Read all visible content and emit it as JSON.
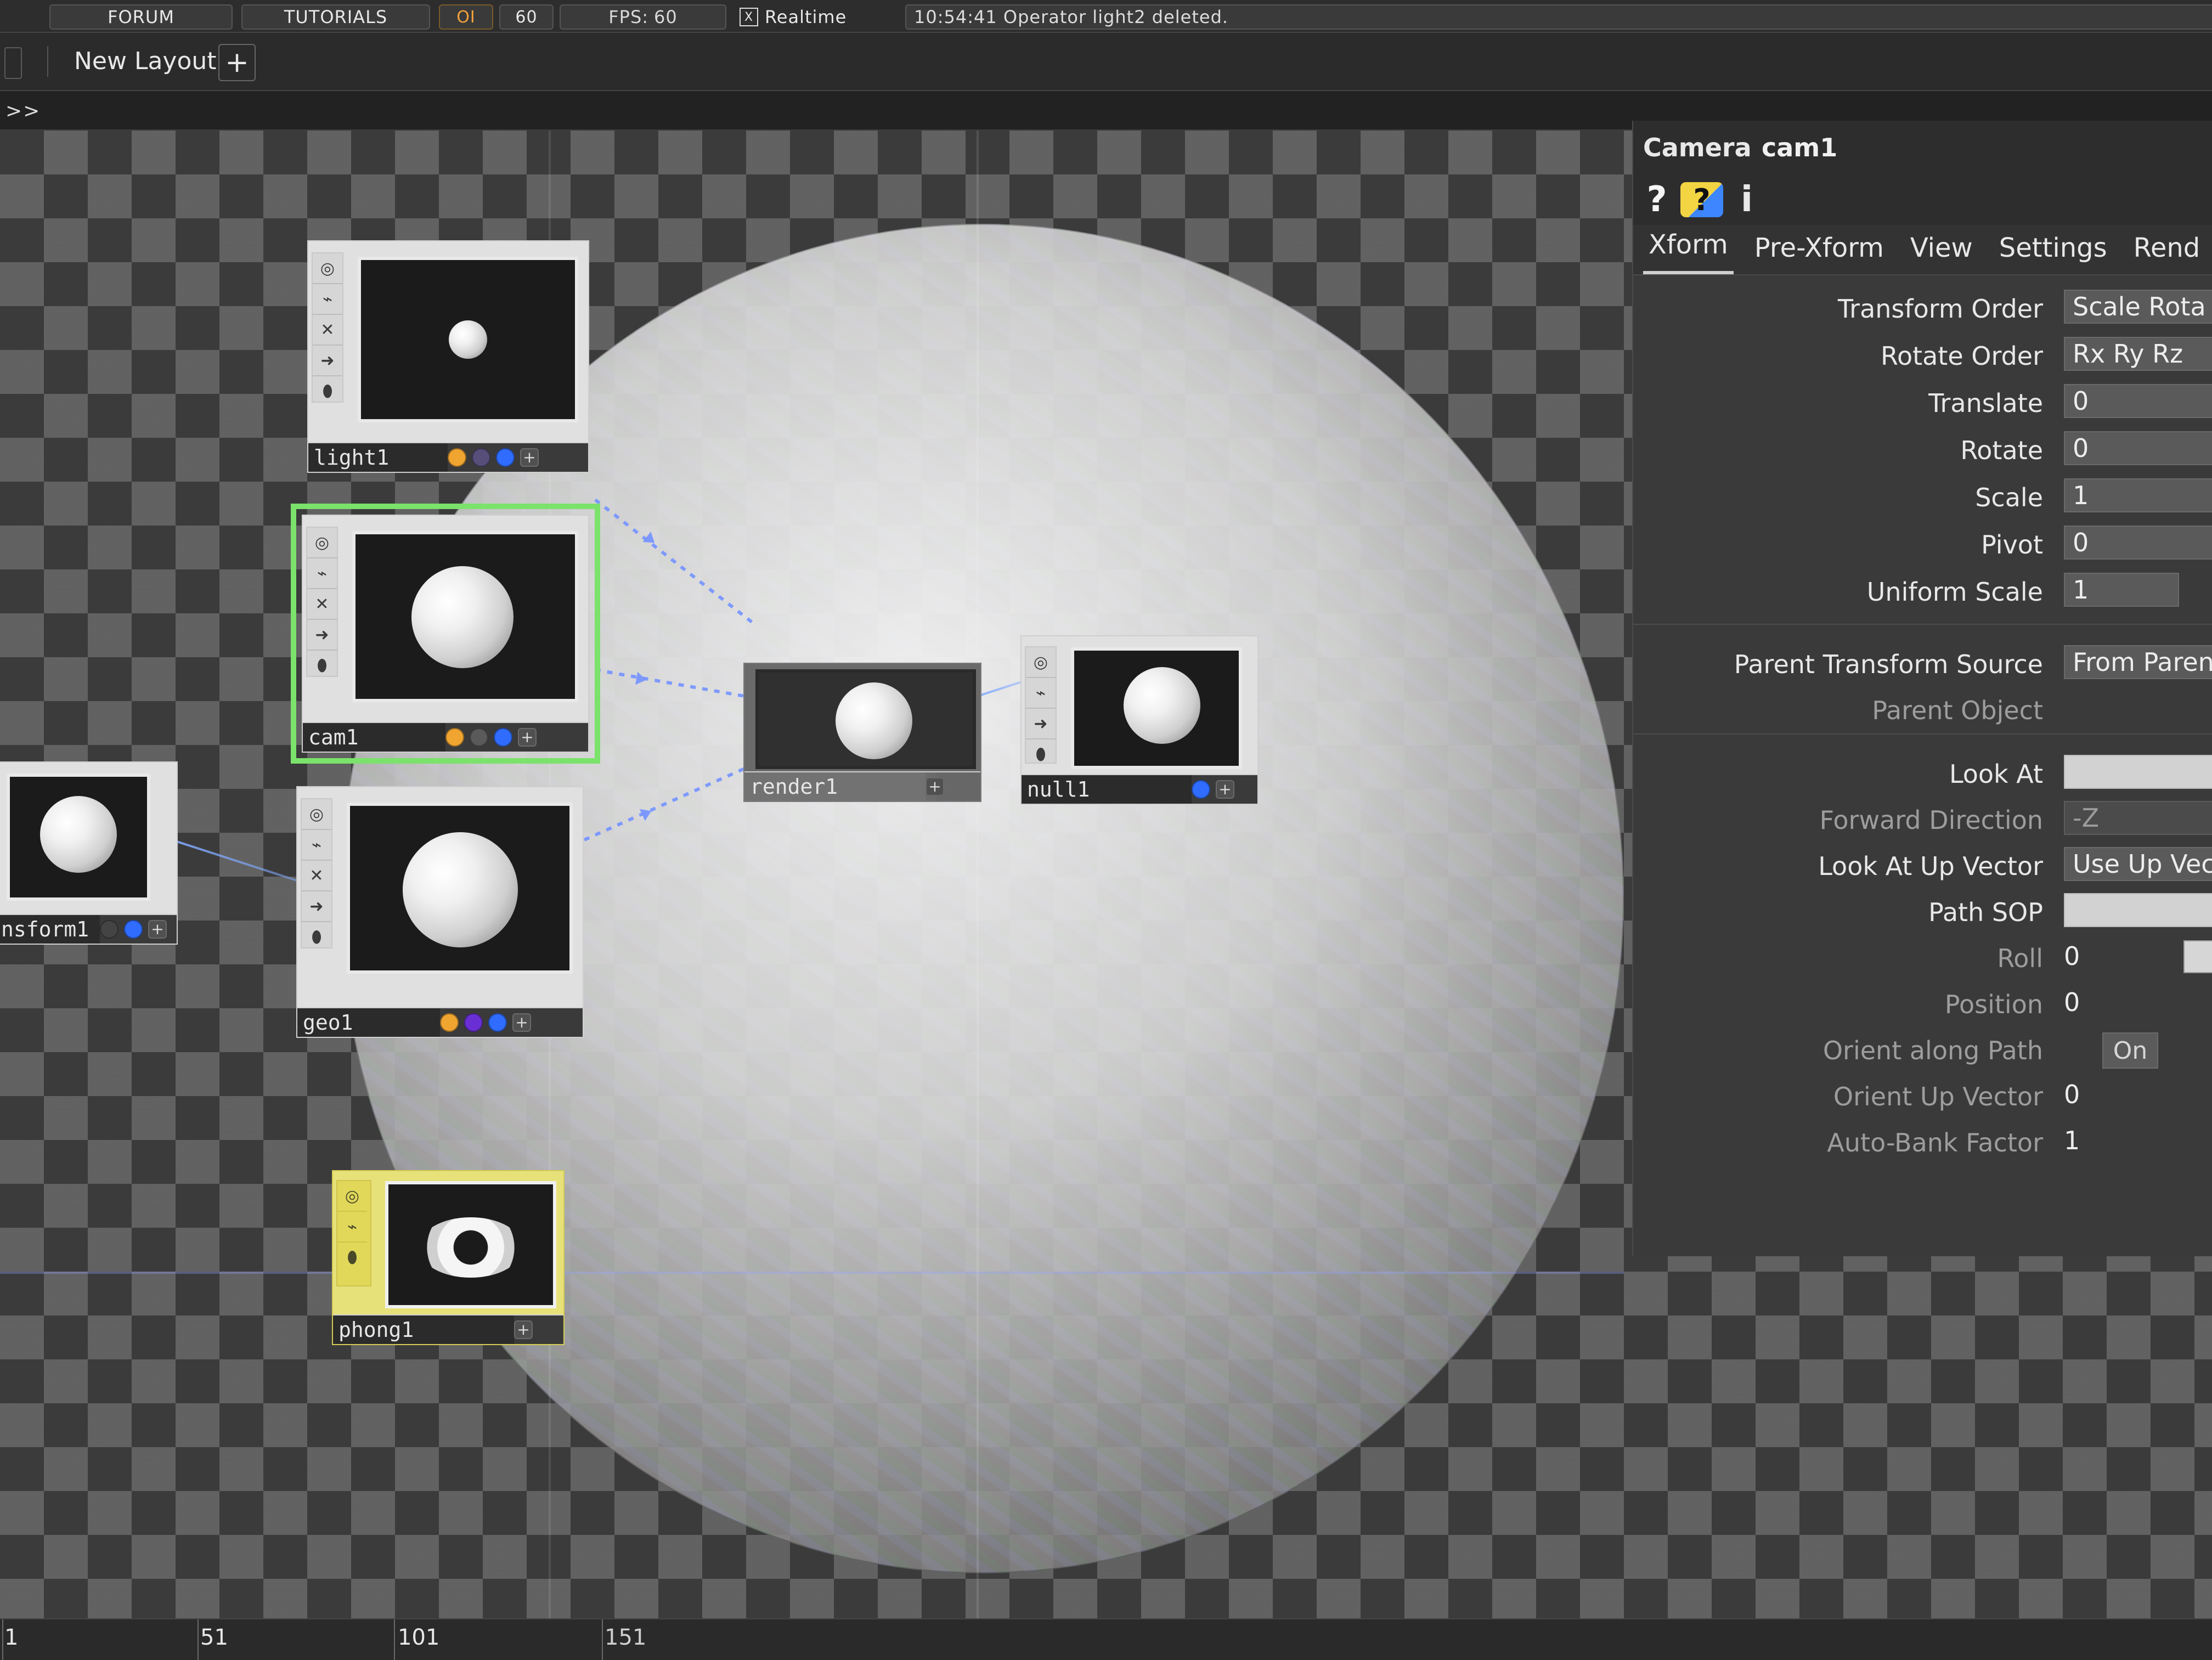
{
  "topbar": {
    "forum": "FORUM",
    "tutorials": "TUTORIALS",
    "oi": "OI",
    "fps_cap": "60",
    "fps_label": "FPS:",
    "fps_value": "60",
    "realtime_checked": "X",
    "realtime_label": "Realtime",
    "message": "10:54:41 Operator light2 deleted."
  },
  "layoutbar": {
    "layout_label": "New Layout",
    "add_glyph": "+"
  },
  "pathbar": {
    "chevrons": ">>"
  },
  "network": {
    "nodes": {
      "light1": {
        "label": "light1"
      },
      "cam1": {
        "label": "cam1"
      },
      "transform1": {
        "label": "nsform1"
      },
      "geo1": {
        "label": "geo1"
      },
      "render1": {
        "label": "render1"
      },
      "null1": {
        "label": "null1"
      },
      "phong1": {
        "label": "phong1"
      }
    }
  },
  "parameters": {
    "operator_type": "Camera",
    "operator_name": "cam1",
    "help_icon_1": "?",
    "help_icon_2": "?",
    "info_icon": "i",
    "tabs": [
      "Xform",
      "Pre-Xform",
      "View",
      "Settings",
      "Rend"
    ],
    "rows": {
      "transform_order": {
        "label": "Transform Order",
        "value": "Scale Rota"
      },
      "rotate_order": {
        "label": "Rotate Order",
        "value": "Rx Ry Rz"
      },
      "translate": {
        "label": "Translate",
        "value": "0"
      },
      "rotate": {
        "label": "Rotate",
        "value": "0"
      },
      "scale": {
        "label": "Scale",
        "value": "1"
      },
      "pivot": {
        "label": "Pivot",
        "value": "0"
      },
      "uniform_scale": {
        "label": "Uniform Scale",
        "value": "1"
      },
      "parent_transform_source": {
        "label": "Parent Transform Source",
        "value": "From Paren"
      },
      "parent_object": {
        "label": "Parent Object",
        "value": ""
      },
      "look_at": {
        "label": "Look At",
        "value": ""
      },
      "forward_direction": {
        "label": "Forward Direction",
        "value": "-Z"
      },
      "look_at_up_vector": {
        "label": "Look At Up Vector",
        "value": "Use Up Vec"
      },
      "path_sop": {
        "label": "Path SOP",
        "value": ""
      },
      "roll": {
        "label": "Roll",
        "value": "0"
      },
      "position": {
        "label": "Position",
        "value": "0"
      },
      "orient_along_path": {
        "label": "Orient along Path",
        "value": "On"
      },
      "orient_up_vector": {
        "label": "Orient Up Vector",
        "value": "0"
      },
      "auto_bank_factor": {
        "label": "Auto-Bank Factor",
        "value": "1"
      }
    }
  },
  "timeline": {
    "labels": [
      "1",
      "51",
      "101",
      "151"
    ]
  }
}
